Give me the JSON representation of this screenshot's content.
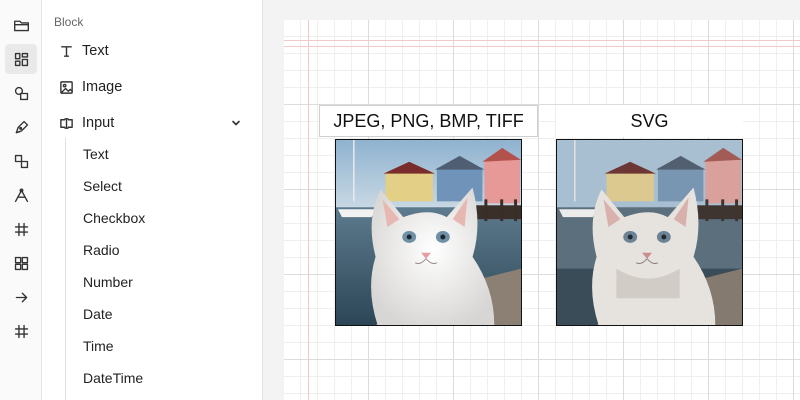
{
  "sidebar": {
    "icons": [
      "folder-icon",
      "blocks-icon",
      "shapes-icon",
      "pen-icon",
      "group-icon",
      "path-icon",
      "grid-icon",
      "layout-icon",
      "arrow-right-icon",
      "hash-icon"
    ]
  },
  "panel": {
    "section_title": "Block",
    "items": [
      {
        "label": "Text",
        "icon": "text-icon"
      },
      {
        "label": "Image",
        "icon": "image-icon"
      },
      {
        "label": "Input",
        "icon": "input-icon"
      }
    ],
    "input_children": [
      "Text",
      "Select",
      "Checkbox",
      "Radio",
      "Number",
      "Date",
      "Time",
      "DateTime"
    ]
  },
  "canvas": {
    "left_card": {
      "label": "JPEG, PNG, BMP, TIFF",
      "image": "cat-on-dock-photo"
    },
    "right_card": {
      "label": "SVG",
      "image": "cat-on-dock-vector"
    }
  },
  "colors": {
    "guide": "#f2c9c9",
    "grid_major": "#dcdcdc",
    "grid_minor": "#efefef"
  }
}
